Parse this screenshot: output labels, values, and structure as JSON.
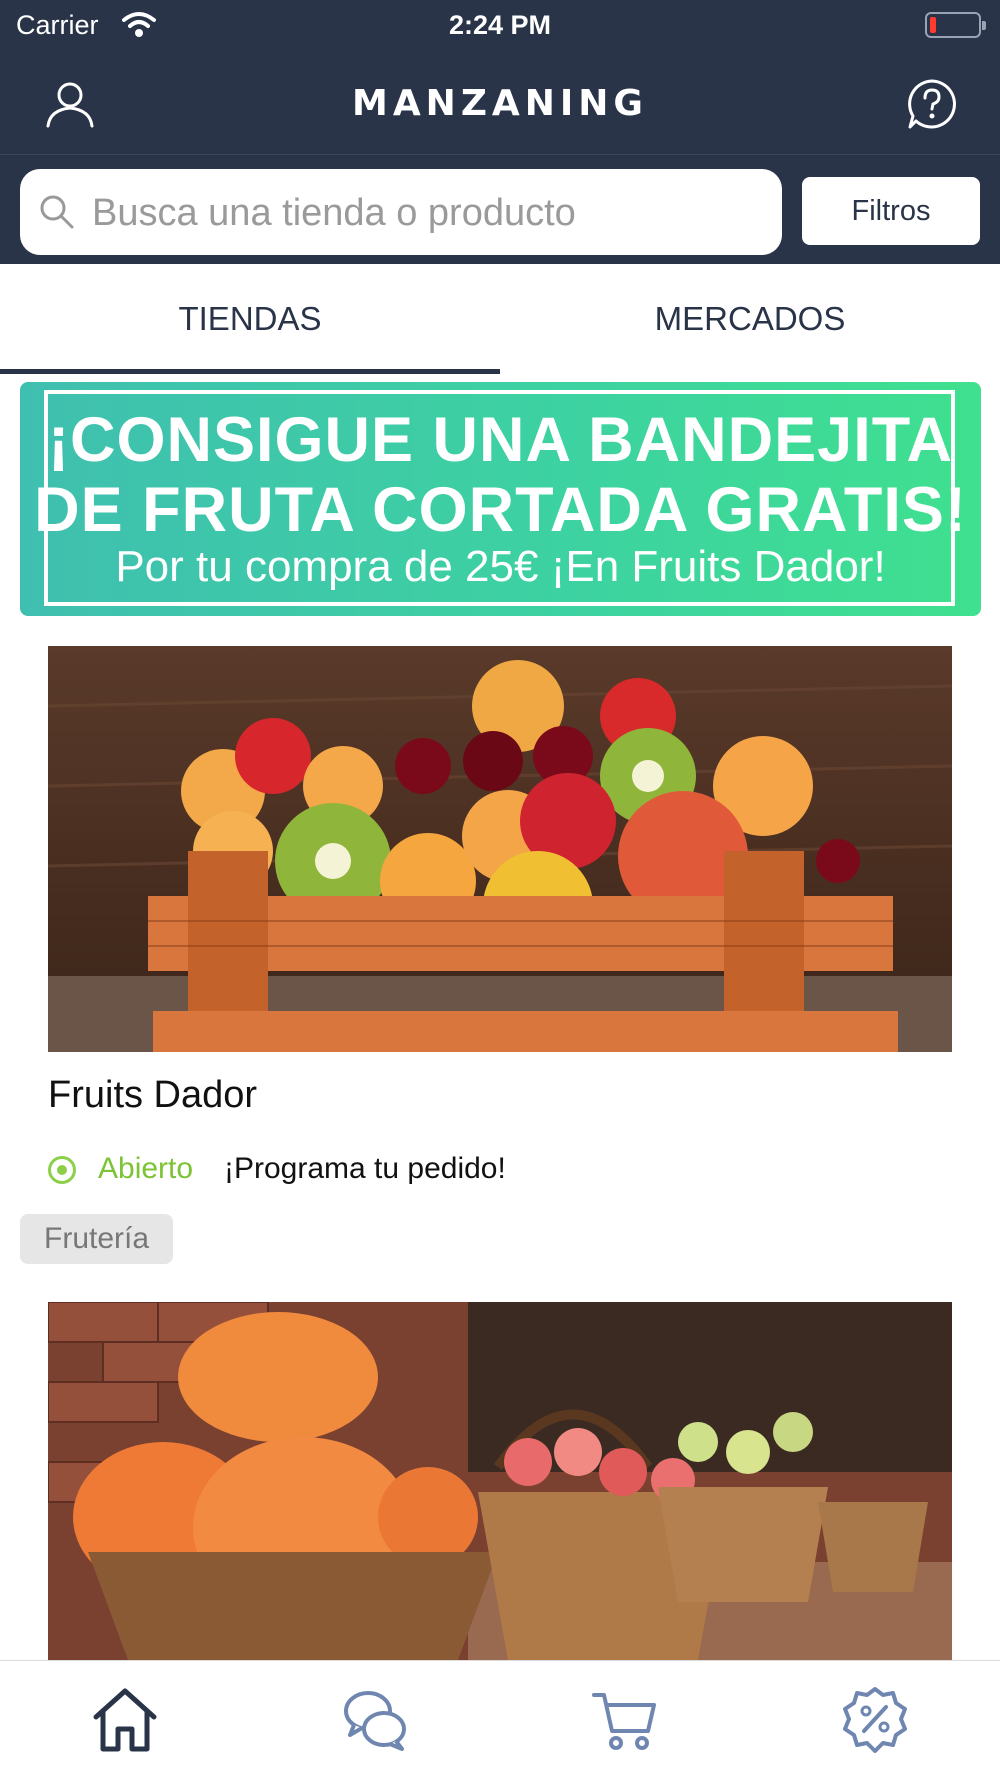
{
  "status_bar": {
    "carrier": "Carrier",
    "time": "2:24 PM"
  },
  "header": {
    "title": "MANZANING"
  },
  "search": {
    "placeholder": "Busca una tienda o producto",
    "value": "",
    "filters_label": "Filtros"
  },
  "tabs": [
    {
      "label": "TIENDAS",
      "active": true
    },
    {
      "label": "MERCADOS",
      "active": false
    }
  ],
  "banner": {
    "line1": "¡CONSIGUE UNA BANDEJITA",
    "line2": "DE FRUTA CORTADA GRATIS!",
    "line3": "Por tu compra de 25€ ¡En Fruits Dador!"
  },
  "stores": [
    {
      "name": "Fruits Dador",
      "status": "Abierto",
      "note": "¡Programa tu pedido!",
      "tag": "Frutería",
      "image": "fruit-crate-photo"
    },
    {
      "image": "pumpkins-and-apple-baskets-photo"
    }
  ],
  "tab_bar": [
    {
      "icon": "home-icon",
      "active": true
    },
    {
      "icon": "chat-icon"
    },
    {
      "icon": "cart-icon"
    },
    {
      "icon": "discount-icon"
    }
  ],
  "colors": {
    "navy": "#2a3448",
    "open_green": "#7cc434",
    "banner_start": "#3fbfb0",
    "banner_end": "#3fe08f"
  }
}
